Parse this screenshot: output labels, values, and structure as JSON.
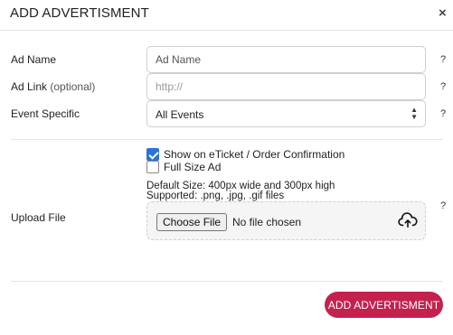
{
  "header": {
    "title": "ADD ADVERTISMENT",
    "close_symbol": "×"
  },
  "form": {
    "ad_name": {
      "label": "Ad Name",
      "placeholder": "Ad Name",
      "value": ""
    },
    "ad_link": {
      "label": "Ad Link",
      "label_suffix": "(optional)",
      "placeholder": "http://",
      "value": ""
    },
    "event_specific": {
      "label": "Event Specific",
      "selected": "All Events",
      "arrows": "▲▼"
    },
    "help_symbol": "?",
    "show_on_eticket": {
      "label": "Show on eTicket / Order Confirmation",
      "checked": true
    },
    "full_size_ad": {
      "label": "Full Size Ad",
      "checked": false
    },
    "default_size": "Default Size: 400px wide and 300px high",
    "supported": "Supported: .png, .jpg, .gif files",
    "upload": {
      "label": "Upload File",
      "button": "Choose File",
      "status": "No file chosen",
      "icon": "cloud-upload-icon"
    }
  },
  "footer": {
    "submit_label": "ADD ADVERTISMENT"
  },
  "colors": {
    "accent": "#c4214f",
    "checkbox": "#2a74d4"
  }
}
